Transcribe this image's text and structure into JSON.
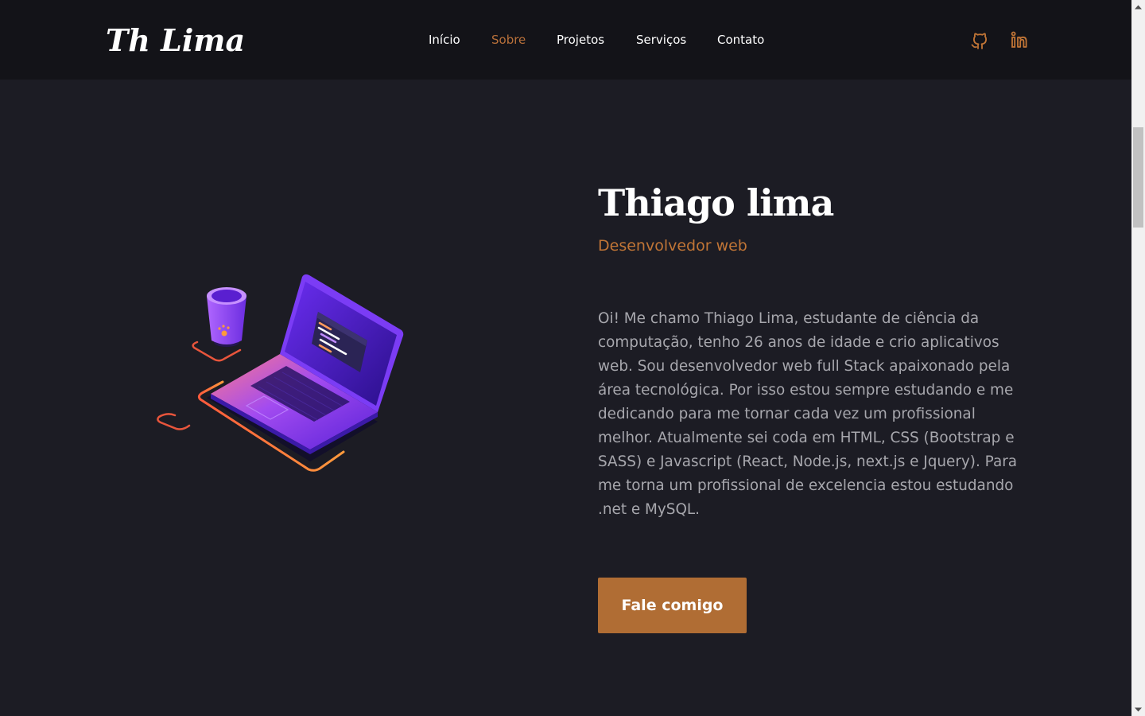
{
  "header": {
    "logo": "Th Lima",
    "nav": [
      {
        "label": "Início",
        "active": false
      },
      {
        "label": "Sobre",
        "active": true
      },
      {
        "label": "Projetos",
        "active": false
      },
      {
        "label": "Serviços",
        "active": false
      },
      {
        "label": "Contato",
        "active": false
      }
    ],
    "social": [
      {
        "icon": "github-icon"
      },
      {
        "icon": "linkedin-icon"
      }
    ]
  },
  "hero": {
    "name": "Thiago lima",
    "role": "Desenvolvedor web",
    "bio": "Oi! Me chamo Thiago Lima, estudante de ciência da computação, tenho 26 anos de idade e crio aplicativos web. Sou desenvolvedor web full Stack apaixonado pela área tecnológica. Por isso estou sempre estudando e me dedicando para me tornar cada vez um profissional melhor. Atualmente sei coda em HTML, CSS (Bootstrap e SASS) e Javascript (React, Node.js, next.js e Jquery). Para me torna um profissional de excelencia estou estudando .net e MySQL.",
    "cta": "Fale comigo",
    "illustration": "laptop-and-coffee-cup-illustration"
  },
  "colors": {
    "background": "#1c1c24",
    "header": "#131318",
    "accent": "#c17536",
    "button": "#b06d34",
    "text_muted": "#a7a7ad"
  }
}
